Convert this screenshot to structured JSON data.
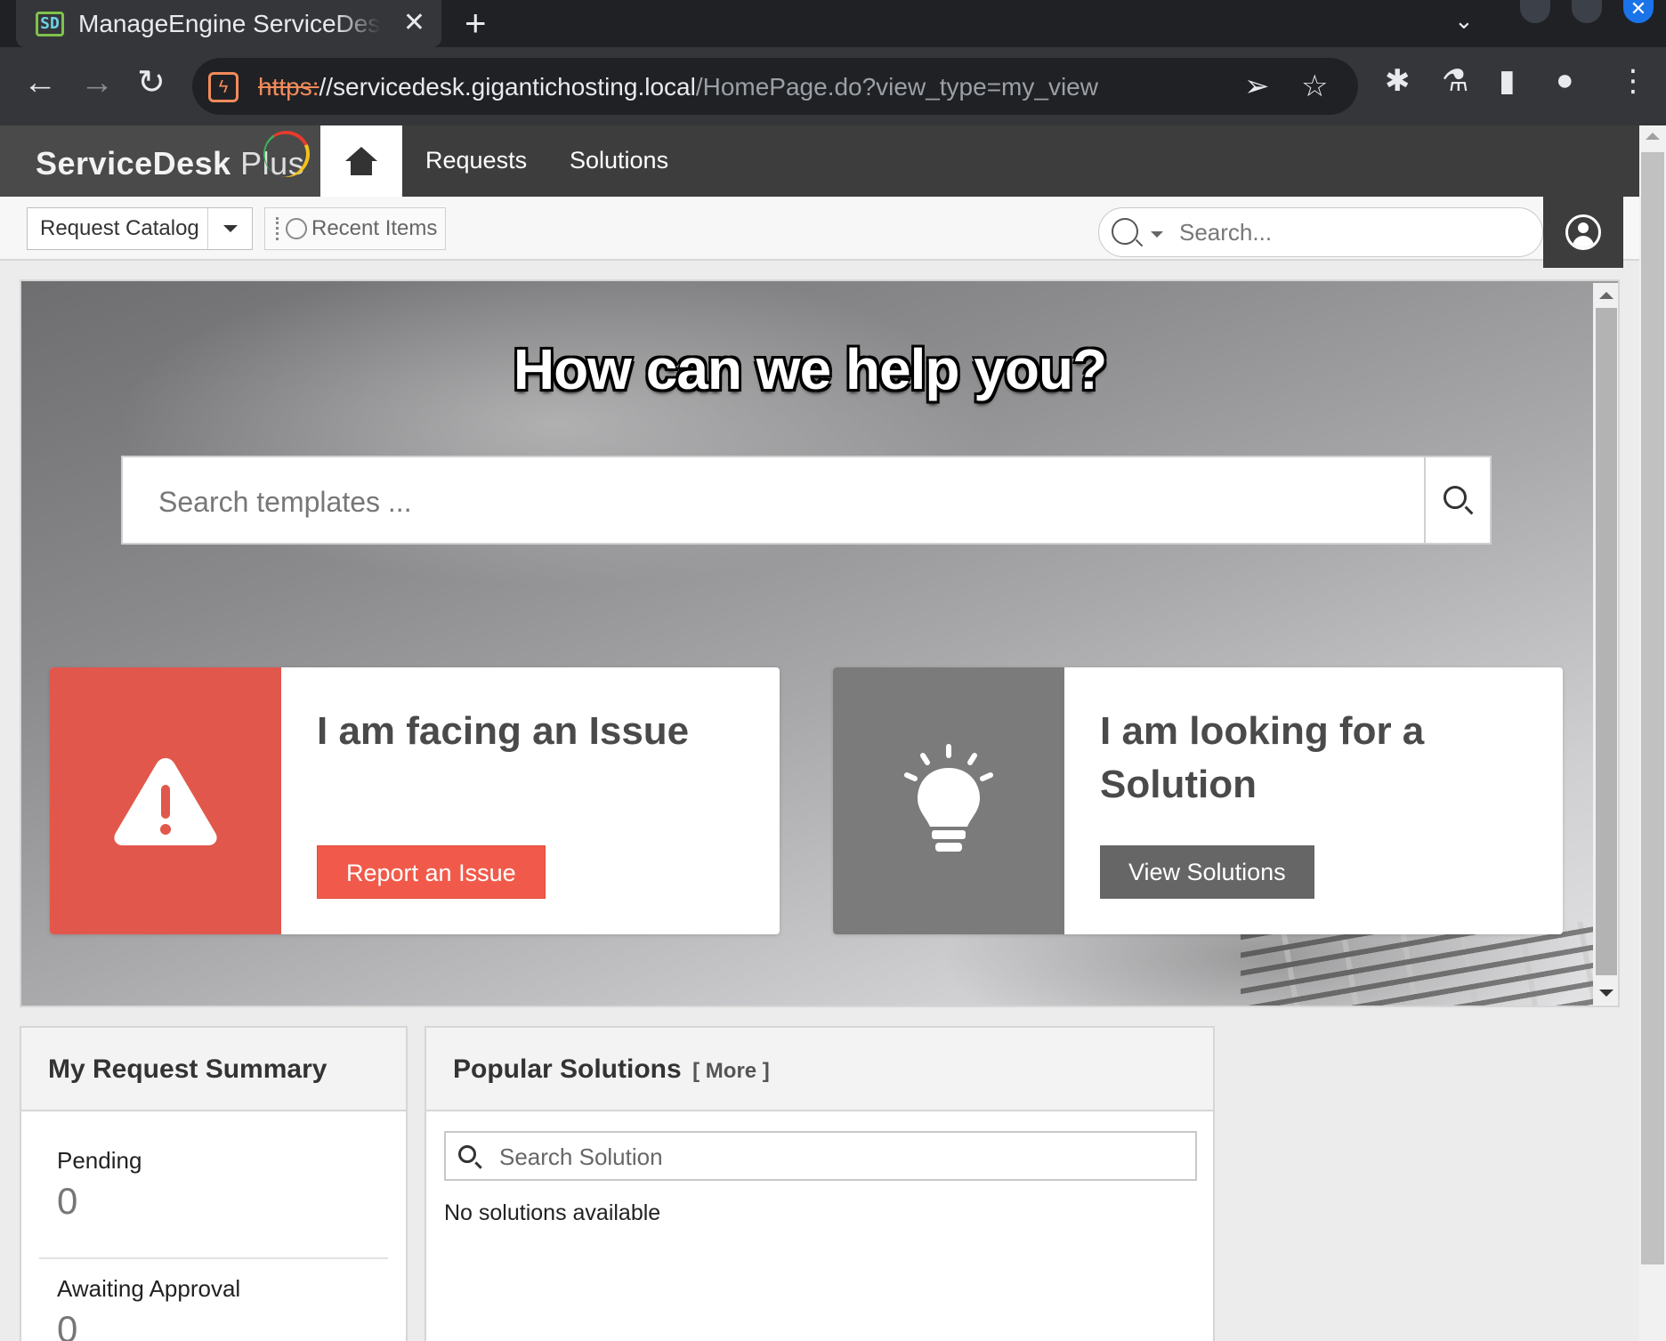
{
  "browser": {
    "tab_title": "ManageEngine ServiceDesk Plus",
    "url_scheme": "https:",
    "url_host": "//servicedesk.gigantichosting.local",
    "url_path": "/HomePage.do?view_type=my_view"
  },
  "app": {
    "logo_main": "ServiceDesk",
    "logo_plus": " Plus",
    "nav": [
      "Requests",
      "Solutions"
    ],
    "catalog_label": "Request Catalog",
    "recent_label": "Recent Items",
    "search_placeholder": "Search..."
  },
  "hero": {
    "title": "How can we help you?",
    "search_placeholder": "Search templates ...",
    "issue_card": {
      "title": "I am facing an Issue",
      "button": "Report an Issue",
      "accent": "#e2574b",
      "button_color": "#f15a4a",
      "icon": "warning-icon"
    },
    "solution_card": {
      "title": "I am looking for a Solution",
      "button": "View Solutions",
      "accent": "#7b7b7b",
      "button_color": "#666666",
      "icon": "lightbulb-icon"
    }
  },
  "summary": {
    "title": "My Request Summary",
    "items": [
      {
        "label": "Pending",
        "value": "0"
      },
      {
        "label": "Awaiting Approval",
        "value": "0"
      }
    ]
  },
  "solutions": {
    "title": "Popular Solutions",
    "more": "[ More ]",
    "search_placeholder": "Search Solution",
    "empty": "No solutions available"
  }
}
